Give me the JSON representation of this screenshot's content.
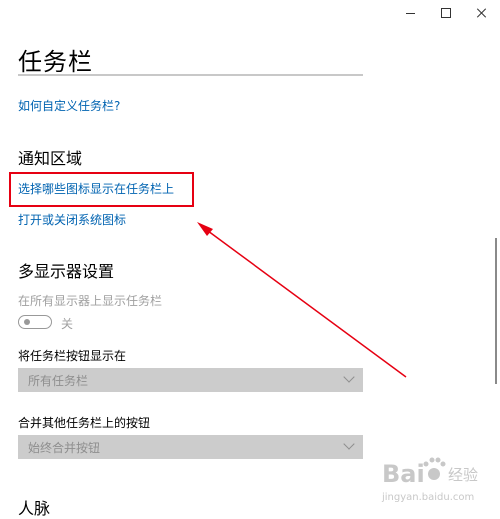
{
  "window": {
    "minimize_label": "—",
    "maximize_label": "☐",
    "close_label": "✕"
  },
  "page": {
    "title": "任务栏",
    "customize_link": "如何自定义任务栏?"
  },
  "notification_area": {
    "heading": "通知区域",
    "select_icons_link": "选择哪些图标显示在任务栏上",
    "system_icons_link": "打开或关闭系统图标"
  },
  "multi_display": {
    "heading": "多显示器设置",
    "show_on_all_label": "在所有显示器上显示任务栏",
    "toggle_state": "关",
    "show_buttons_label": "将任务栏按钮显示在",
    "show_buttons_value": "所有任务栏",
    "combine_label": "合并其他任务栏上的按钮",
    "combine_value": "始终合并按钮"
  },
  "people": {
    "heading": "人脉"
  },
  "annotation": {
    "box_color": "#e60012",
    "arrow_color": "#e60012"
  },
  "watermark": {
    "brand": "Bai",
    "brand_suffix": "经验",
    "url": "jingyan.baidu.com"
  },
  "colors": {
    "link": "#0063b1",
    "disabled_text": "#a0a0a0",
    "dropdown_bg": "#cccccc"
  }
}
